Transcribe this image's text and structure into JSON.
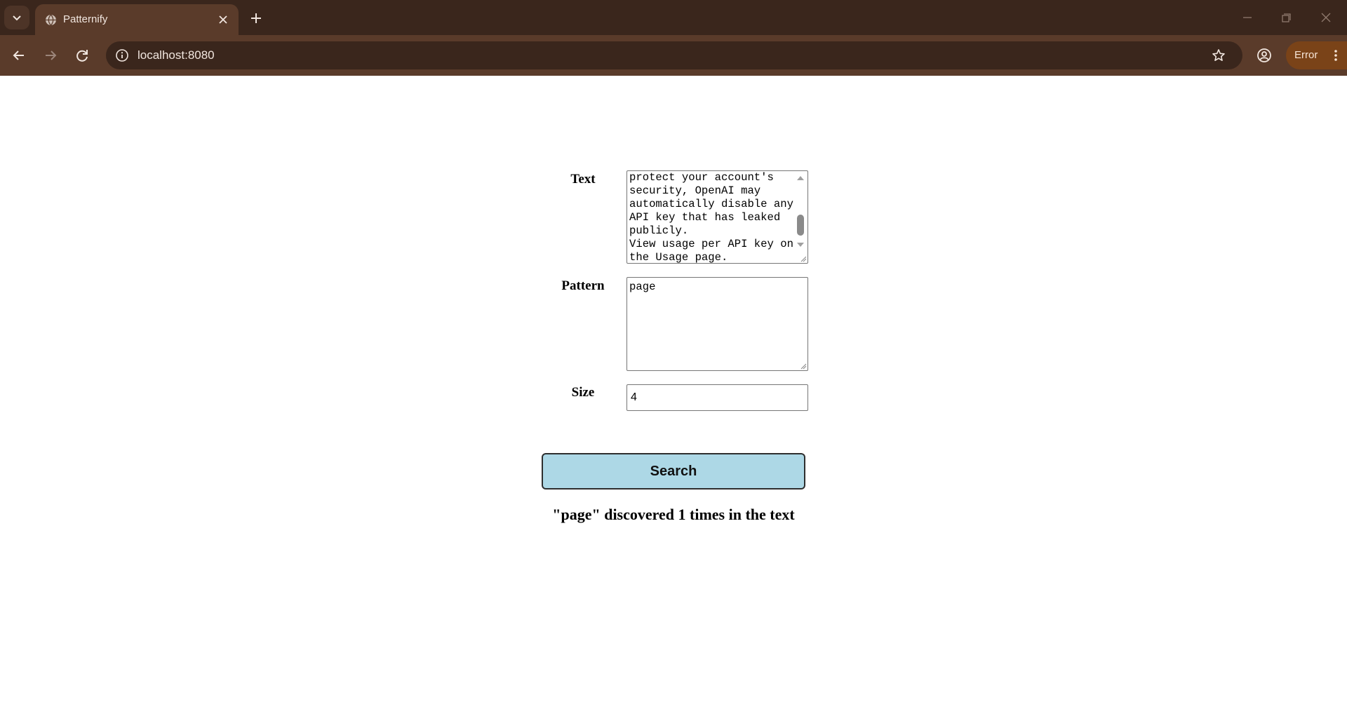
{
  "browser": {
    "tab": {
      "title": "Patternify",
      "favicon": "globe-icon"
    },
    "address": {
      "url": "localhost:8080"
    },
    "profile_status": "Error",
    "colors": {
      "chrome_dark": "#3a261c",
      "chrome_mid": "#5a3b2a",
      "error_pill": "#7a4318"
    }
  },
  "form": {
    "text_label": "Text",
    "text_value": "protect your account's security, OpenAI may automatically disable any API key that has leaked publicly.\nView usage per API key on the Usage page.",
    "pattern_label": "Pattern",
    "pattern_value": "page",
    "size_label": "Size",
    "size_value": "4",
    "search_label": "Search"
  },
  "result": {
    "message": "\"page\" discovered 1 times in the text"
  },
  "colors": {
    "search_button": "#add8e6"
  }
}
